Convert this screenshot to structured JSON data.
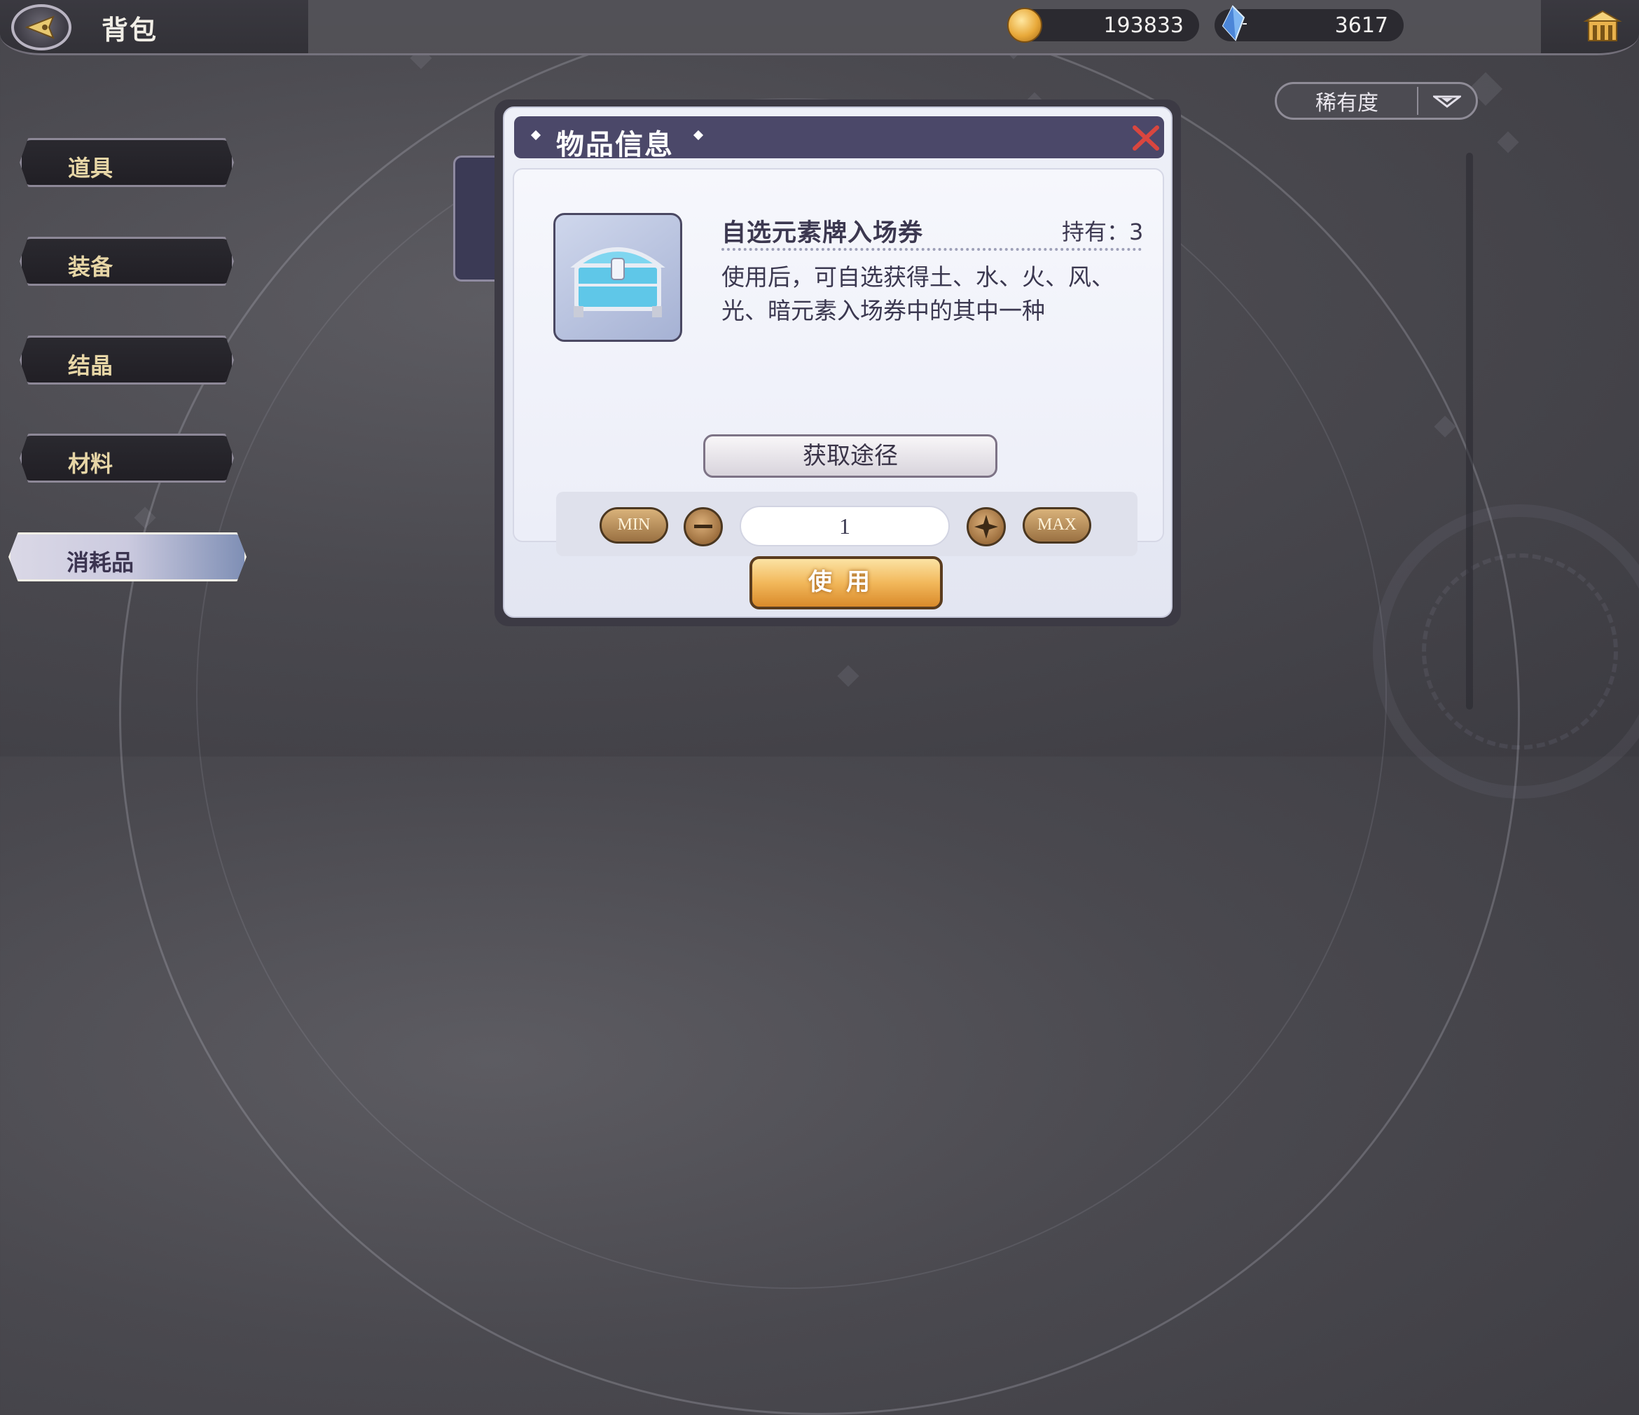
{
  "header": {
    "title": "背包",
    "gold_amount": "193833",
    "gem_amount": "3617"
  },
  "sidebar": {
    "tabs": [
      {
        "label": "道具",
        "active": false
      },
      {
        "label": "装备",
        "active": false
      },
      {
        "label": "结晶",
        "active": false
      },
      {
        "label": "材料",
        "active": false
      },
      {
        "label": "消耗品",
        "active": true
      }
    ]
  },
  "sort": {
    "label": "稀有度"
  },
  "dialog": {
    "title": "物品信息",
    "item_name": "自选元素牌入场券",
    "owned_text": "持有：3",
    "description": "使用后，可自选获得土、水、火、风、光、暗元素入场券中的其中一种",
    "source_button": "获取途径",
    "min_label": "MIN",
    "max_label": "MAX",
    "quantity": "1",
    "use_button": "使用"
  },
  "colors": {
    "accent_gold": "#f2b85b",
    "header_purple": "#4b4869",
    "close_red": "#d9463f"
  }
}
